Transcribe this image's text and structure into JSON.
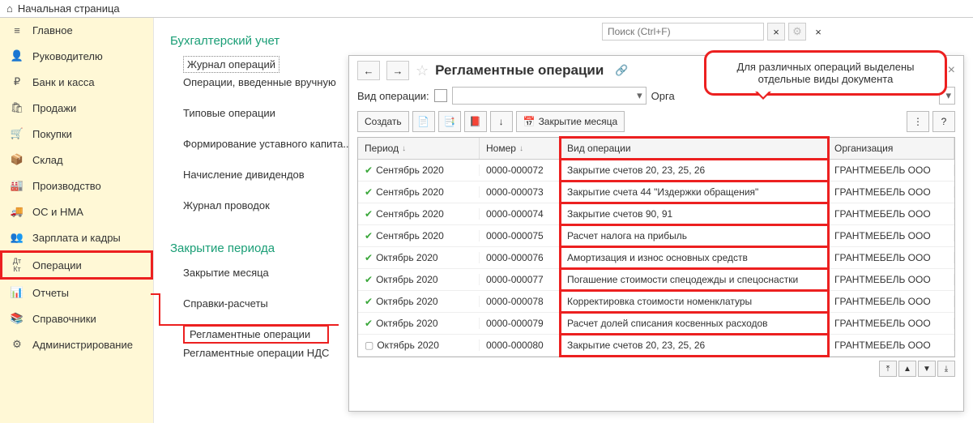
{
  "topbar": {
    "home": "Начальная страница"
  },
  "sidebar": {
    "items": [
      {
        "icon": "≡",
        "label": "Главное"
      },
      {
        "icon": "👤",
        "label": "Руководителю"
      },
      {
        "icon": "₽",
        "label": "Банк и касса"
      },
      {
        "icon": "🛍",
        "label": "Продажи"
      },
      {
        "icon": "🛒",
        "label": "Покупки"
      },
      {
        "icon": "📦",
        "label": "Склад"
      },
      {
        "icon": "🏭",
        "label": "Производство"
      },
      {
        "icon": "🚚",
        "label": "ОС и НМА"
      },
      {
        "icon": "👥",
        "label": "Зарплата и кадры"
      },
      {
        "icon": "Дт Кт",
        "label": "Операции"
      },
      {
        "icon": "📊",
        "label": "Отчеты"
      },
      {
        "icon": "📚",
        "label": "Справочники"
      },
      {
        "icon": "⚙",
        "label": "Администрирование"
      }
    ]
  },
  "sections": {
    "s1": {
      "title": "Бухгалтерский учет",
      "links": [
        "Журнал операций",
        "Операции, введенные вручную",
        "Типовые операции",
        "Формирование уставного капита...",
        "Начисление дивидендов",
        "Журнал проводок"
      ]
    },
    "s2": {
      "title": "Закрытие периода",
      "links": [
        "Закрытие месяца",
        "Справки-расчеты",
        "Регламентные операции",
        "Регламентные операции НДС"
      ]
    }
  },
  "search": {
    "placeholder": "Поиск (Ctrl+F)"
  },
  "panel": {
    "title": "Регламентные операции",
    "filter": {
      "label_vid": "Вид операции:",
      "label_org": "Орга"
    },
    "toolbar": {
      "create": "Создать",
      "close_month": "Закрытие месяца"
    },
    "callout": "Для различных операций выделены отдельные виды документа",
    "columns": {
      "period": "Период",
      "num": "Номер",
      "op": "Вид операции",
      "org": "Организация"
    },
    "rows": [
      {
        "ok": true,
        "period": "Сентябрь 2020",
        "num": "0000-000072",
        "op": "Закрытие счетов 20, 23, 25, 26",
        "org": "ГРАНТМЕБЕЛЬ ООО"
      },
      {
        "ok": true,
        "period": "Сентябрь 2020",
        "num": "0000-000073",
        "op": "Закрытие счета 44 \"Издержки обращения\"",
        "org": "ГРАНТМЕБЕЛЬ ООО"
      },
      {
        "ok": true,
        "period": "Сентябрь 2020",
        "num": "0000-000074",
        "op": "Закрытие счетов 90, 91",
        "org": "ГРАНТМЕБЕЛЬ ООО"
      },
      {
        "ok": true,
        "period": "Сентябрь 2020",
        "num": "0000-000075",
        "op": "Расчет налога на прибыль",
        "org": "ГРАНТМЕБЕЛЬ ООО"
      },
      {
        "ok": true,
        "period": "Октябрь 2020",
        "num": "0000-000076",
        "op": "Амортизация и износ основных средств",
        "org": "ГРАНТМЕБЕЛЬ ООО"
      },
      {
        "ok": true,
        "period": "Октябрь 2020",
        "num": "0000-000077",
        "op": "Погашение стоимости спецодежды и спецоснастки",
        "org": "ГРАНТМЕБЕЛЬ ООО"
      },
      {
        "ok": true,
        "period": "Октябрь 2020",
        "num": "0000-000078",
        "op": "Корректировка стоимости номенклатуры",
        "org": "ГРАНТМЕБЕЛЬ ООО"
      },
      {
        "ok": true,
        "period": "Октябрь 2020",
        "num": "0000-000079",
        "op": "Расчет долей списания косвенных расходов",
        "org": "ГРАНТМЕБЕЛЬ ООО"
      },
      {
        "ok": false,
        "period": "Октябрь 2020",
        "num": "0000-000080",
        "op": "Закрытие счетов 20, 23, 25, 26",
        "org": "ГРАНТМЕБЕЛЬ ООО"
      }
    ]
  }
}
